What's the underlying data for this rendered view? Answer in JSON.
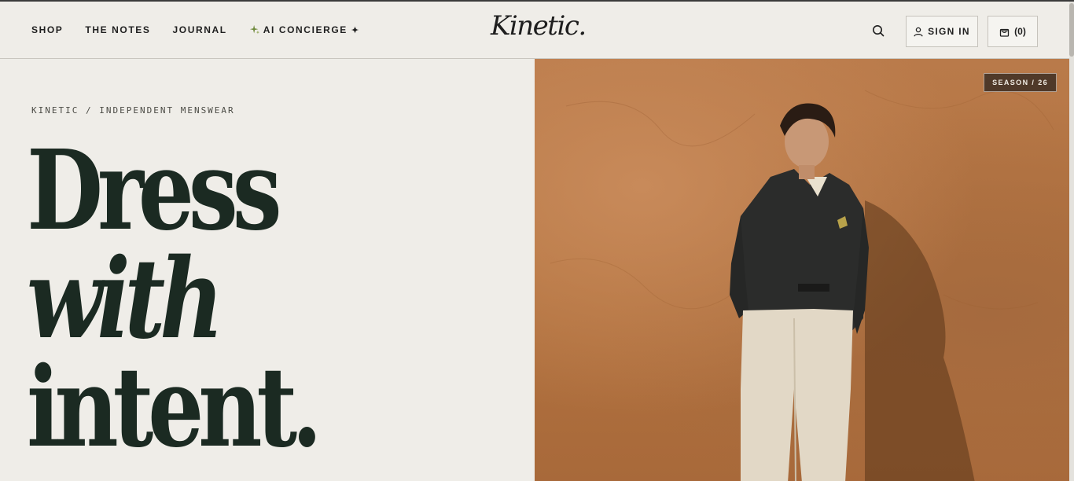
{
  "header": {
    "nav": [
      {
        "label": "SHOP"
      },
      {
        "label": "THE NOTES"
      },
      {
        "label": "JOURNAL"
      },
      {
        "label": "AI CONCIERGE",
        "suffix": "✦"
      }
    ],
    "logo": "Kinetic.",
    "signin_label": "SIGN IN",
    "cart_label": "(0)"
  },
  "hero": {
    "eyebrow": "KINETIC / INDEPENDENT MENSWEAR",
    "headline": [
      "Dress",
      "with",
      "intent."
    ],
    "season_tag": "SEASON / 26"
  },
  "colors": {
    "background": "#efede8",
    "headline": "#1b2a22",
    "wall": "#b3733f",
    "sparkle": "#6f8a3c"
  },
  "icons": {
    "search": "search-icon",
    "user": "user-icon",
    "bag": "shopping-bag-icon",
    "sparkle": "sparkle-icon"
  }
}
